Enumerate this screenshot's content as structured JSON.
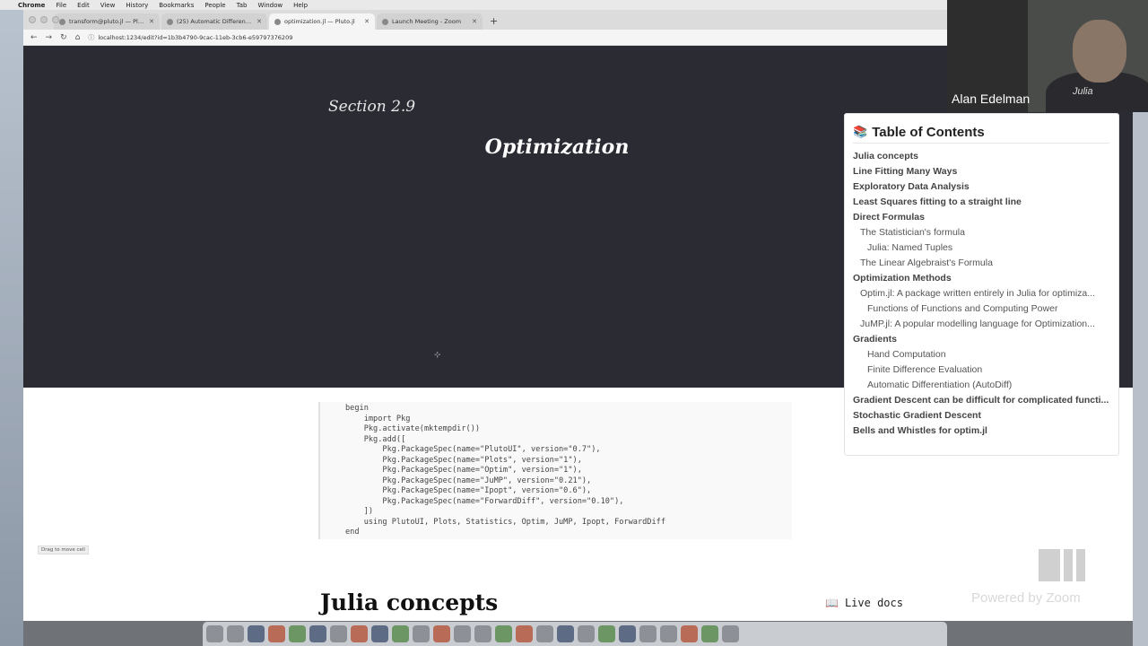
{
  "menubar": {
    "apple": "",
    "app": "Chrome",
    "items": [
      "File",
      "Edit",
      "View",
      "History",
      "Bookmarks",
      "People",
      "Tab",
      "Window",
      "Help"
    ]
  },
  "browser": {
    "tabs": [
      {
        "label": "transform@pluto.jl — Pluto",
        "active": false
      },
      {
        "label": "(25) Automatic Differentiation",
        "active": false
      },
      {
        "label": "optimization.jl — Pluto.jl",
        "active": true
      },
      {
        "label": "Launch Meeting - Zoom",
        "active": false
      }
    ],
    "new_tab": "+",
    "url": "localhost:1234/edit?id=1b3b4790-9cac-11eb-3cb6-e59797376209",
    "nav": {
      "back": "←",
      "forward": "→",
      "reload": "↻",
      "home": "⌂",
      "lock": "ⓘ"
    }
  },
  "notebook": {
    "section": "Section 2.9",
    "title": "Optimization",
    "code_lines": [
      "begin",
      "    import Pkg",
      "    Pkg.activate(mktempdir())",
      "    Pkg.add([",
      "        Pkg.PackageSpec(name=\"PlutoUI\", version=\"0.7\"),",
      "        Pkg.PackageSpec(name=\"Plots\", version=\"1\"),",
      "        Pkg.PackageSpec(name=\"Optim\", version=\"1\"),",
      "        Pkg.PackageSpec(name=\"JuMP\", version=\"0.21\"),",
      "        Pkg.PackageSpec(name=\"Ipopt\", version=\"0.6\"),",
      "        Pkg.PackageSpec(name=\"ForwardDiff\", version=\"0.10\"),",
      "    ])",
      "    using PlutoUI, Plots, Statistics, Optim, JuMP, Ipopt, ForwardDiff",
      "end"
    ],
    "drag_hint": "Drag to move cell",
    "next_heading": "Julia concepts"
  },
  "toc": {
    "title": "Table of Contents",
    "items": [
      {
        "label": "Julia concepts",
        "level": 1
      },
      {
        "label": "Line Fitting Many Ways",
        "level": 1
      },
      {
        "label": "Exploratory Data Analysis",
        "level": 1
      },
      {
        "label": "Least Squares fitting to a straight line",
        "level": 1
      },
      {
        "label": "Direct Formulas",
        "level": 1
      },
      {
        "label": "The Statistician's formula",
        "level": 2
      },
      {
        "label": "Julia: Named Tuples",
        "level": 3
      },
      {
        "label": "The Linear Algebraist's Formula",
        "level": 2
      },
      {
        "label": "Optimization Methods",
        "level": 1
      },
      {
        "label": "Optim.jl: A package written entirely in Julia for optimiza...",
        "level": 2
      },
      {
        "label": "Functions of Functions and Computing Power",
        "level": 3
      },
      {
        "label": "JuMP.jl: A popular modelling language for Optimization...",
        "level": 2
      },
      {
        "label": "Gradients",
        "level": 1
      },
      {
        "label": "Hand Computation",
        "level": 3
      },
      {
        "label": "Finite Difference Evaluation",
        "level": 3
      },
      {
        "label": "Automatic Differentiation (AutoDiff)",
        "level": 3
      },
      {
        "label": "Gradient Descent can be difficult for complicated functi...",
        "level": 1
      },
      {
        "label": "Stochastic Gradient Descent",
        "level": 1
      },
      {
        "label": "Bells and Whistles for optim.jl",
        "level": 1
      }
    ]
  },
  "live_docs": {
    "icon": "book-icon",
    "label": "Live docs"
  },
  "webcam": {
    "name": "Alan Edelman",
    "tag": "Julia"
  },
  "zoom": {
    "watermark": "Powered by Zoom"
  },
  "colors": {
    "hero_bg": "#2a2b33",
    "page_bg": "#ffffff",
    "toc_text": "#555555"
  }
}
